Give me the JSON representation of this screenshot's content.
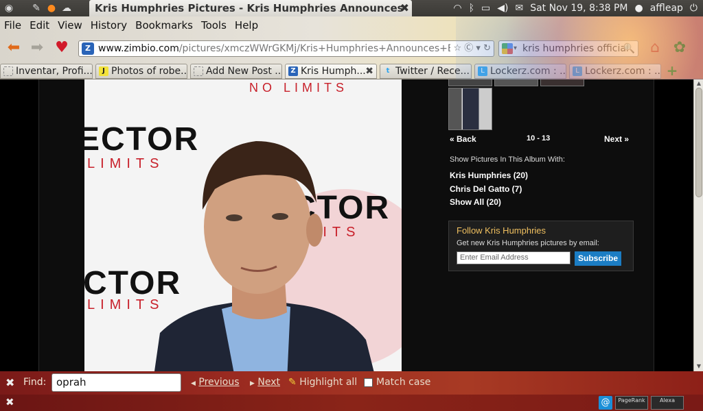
{
  "system_panel": {
    "window_title": "Kris Humphries Pictures - Kris Humphries Announces Br...",
    "datetime": "Sat Nov 19,  8:38 PM",
    "user": "affleap"
  },
  "menubar": {
    "items": [
      {
        "label": "File"
      },
      {
        "label": "Edit"
      },
      {
        "label": "View"
      },
      {
        "label": "History"
      },
      {
        "label": "Bookmarks"
      },
      {
        "label": "Tools"
      },
      {
        "label": "Help"
      }
    ]
  },
  "navbar": {
    "url_domain": "www.zimbio.com",
    "url_path": "/pictures/xmczWWrGKMj/Kris+Humphries+Announces+Bra",
    "search_value": "kris humphries official"
  },
  "tabs": [
    {
      "label": "Inventar, Profi...",
      "icon": "blank-page-icon",
      "active": false
    },
    {
      "label": "Photos of robe...",
      "icon": "j-favicon",
      "active": false
    },
    {
      "label": "Add New Post ...",
      "icon": "blank-page-icon",
      "active": false
    },
    {
      "label": "Kris Humph...",
      "icon": "zimbio-favicon",
      "active": true
    },
    {
      "label": "Twitter / Rece...",
      "icon": "twitter-favicon",
      "active": false
    },
    {
      "label": "Lockerz.com : ...",
      "icon": "lockerz-favicon",
      "active": false
    },
    {
      "label": "Lockerz.com : ...",
      "icon": "lockerz-favicon",
      "active": false
    }
  ],
  "photo": {
    "slogan": "NO LIMITS",
    "logo_word": "ECTOR",
    "logo_sub": "LIMITS"
  },
  "sidebar": {
    "back_label": "« Back",
    "range_label": "10 - 13",
    "next_label": "Next »",
    "album_heading": "Show Pictures In This Album With:",
    "album_links": [
      {
        "label": "Kris Humphries (20)"
      },
      {
        "label": "Chris Del Gatto (7)"
      },
      {
        "label": "Show All (20)"
      }
    ],
    "follow": {
      "title": "Follow Kris Humphries",
      "description": "Get new Kris Humphries pictures by email:",
      "email_placeholder": "Enter Email Address",
      "subscribe_label": "Subscribe"
    }
  },
  "findbar": {
    "label": "Find:",
    "query": "oprah",
    "previous_label": "Previous",
    "next_label": "Next",
    "highlight_label": "Highlight all",
    "match_case_label": "Match case"
  },
  "statusbar": {
    "addon_pagerank": "PageRank",
    "addon_alexa": "Alexa"
  },
  "colors": {
    "accent_blue": "#1b7dc4",
    "follow_title": "#f0c060",
    "findbar_red": "#9a2a20"
  }
}
